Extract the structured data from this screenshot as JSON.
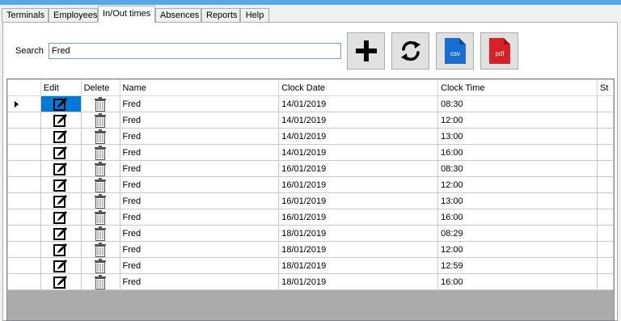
{
  "tabs": [
    "Terminals",
    "Employees",
    "In/Out times",
    "Absences",
    "Reports",
    "Help"
  ],
  "active_tab": "In/Out times",
  "search": {
    "label": "Search",
    "value": "Fred"
  },
  "toolbar": {
    "add_icon": "plus-icon",
    "refresh_icon": "refresh-icon",
    "csv_label": "csv",
    "pdf_label": "pdf"
  },
  "colors": {
    "csv": "#1a6ed1",
    "pdf": "#d72027",
    "selection": "#0078d7",
    "title_bar": "#5aa7e6"
  },
  "columns": [
    "Edit",
    "Delete",
    "Name",
    "Clock Date",
    "Clock Time",
    "St"
  ],
  "rows": [
    {
      "name": "Fred",
      "date": "14/01/2019",
      "time": "08:30"
    },
    {
      "name": "Fred",
      "date": "14/01/2019",
      "time": "12:00"
    },
    {
      "name": "Fred",
      "date": "14/01/2019",
      "time": "13:00"
    },
    {
      "name": "Fred",
      "date": "14/01/2019",
      "time": "16:00"
    },
    {
      "name": "Fred",
      "date": "16/01/2019",
      "time": "08:30"
    },
    {
      "name": "Fred",
      "date": "16/01/2019",
      "time": "12:00"
    },
    {
      "name": "Fred",
      "date": "16/01/2019",
      "time": "13:00"
    },
    {
      "name": "Fred",
      "date": "16/01/2019",
      "time": "16:00"
    },
    {
      "name": "Fred",
      "date": "18/01/2019",
      "time": "08:29"
    },
    {
      "name": "Fred",
      "date": "18/01/2019",
      "time": "12:00"
    },
    {
      "name": "Fred",
      "date": "18/01/2019",
      "time": "12:59"
    },
    {
      "name": "Fred",
      "date": "18/01/2019",
      "time": "16:00"
    }
  ]
}
